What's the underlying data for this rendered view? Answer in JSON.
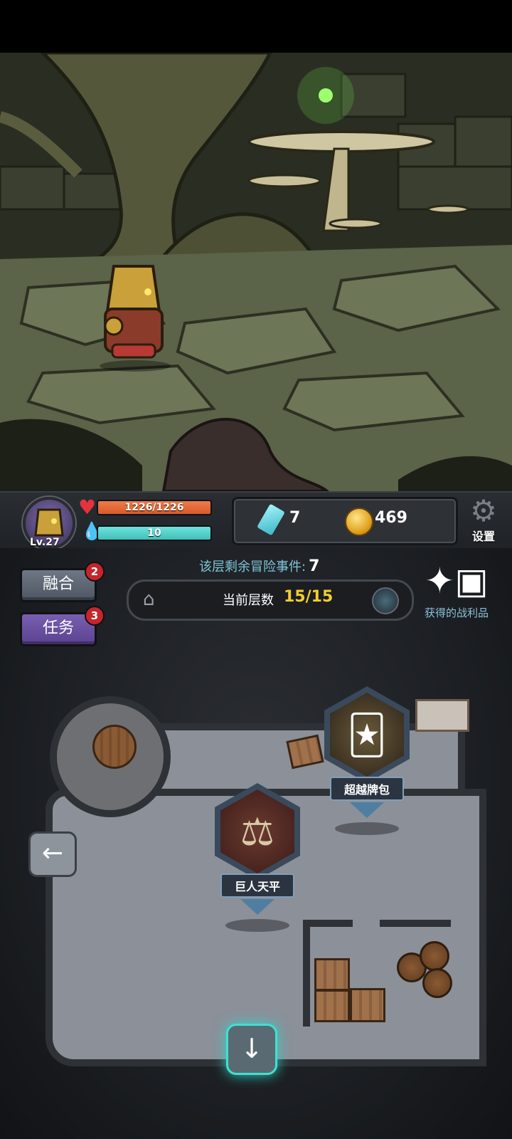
{
  "hud": {
    "level": "Lv.27",
    "hp": "1226/1226",
    "mp": "10",
    "crystals": "7",
    "gold": "469",
    "settings_label": "设置"
  },
  "side_buttons": [
    {
      "label": "融合",
      "badge": "2"
    },
    {
      "label": "任务",
      "badge": "3"
    }
  ],
  "events": {
    "label": "该层剩余冒险事件:",
    "count": "7"
  },
  "floor": {
    "label": "当前层数",
    "value": "15/15"
  },
  "loot": {
    "label": "获得的战利品"
  },
  "map_nodes": [
    {
      "label": "超越牌包",
      "icon": "card-pack-icon"
    },
    {
      "label": "巨人天平",
      "icon": "scales-icon"
    }
  ],
  "colors": {
    "hp": "#d65a2b",
    "mp": "#3fbfb8",
    "floor_value": "#f1cf2d",
    "accent_glow": "#3fe0d3",
    "task_button": "#5a4390"
  }
}
